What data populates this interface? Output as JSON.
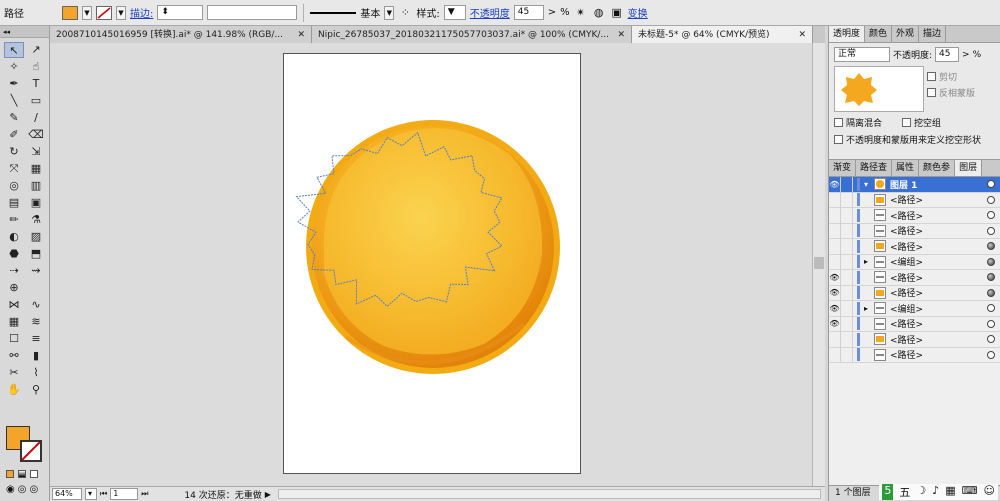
{
  "control": {
    "object_type": "路径",
    "stroke_label": "描边:",
    "stroke_style": "基本",
    "style_label": "样式:",
    "opacity_label": "不透明度",
    "opacity_value": "45",
    "opacity_unit": "%",
    "transform_label": "变换",
    "fill_color": "#f2a52a"
  },
  "tabs": [
    {
      "label": "20087101450169​59 [转换].ai* @ 141.98% (RGB/..."
    },
    {
      "label": "Nipic_26785037_20180321175057703037.ai* @ 100% (CMYK/..."
    },
    {
      "label": "未标题-5* @ 64% (CMYK/预览)"
    }
  ],
  "tools": [
    "↖",
    "↗",
    "✧",
    "☝",
    "✒",
    "T",
    "╲",
    "▭",
    "✎",
    "∕",
    "✐",
    "⌫",
    "↻",
    "⇲",
    "⤧",
    "▦",
    "◎",
    "▥",
    "▤",
    "▣",
    "✏",
    "⚗",
    "◐",
    "▨",
    "⬣",
    "⬒",
    "⇢",
    "⇝",
    "⊕",
    "",
    "⋈",
    "∿",
    "▦",
    "≋",
    "☐",
    "≡",
    "⚯",
    "▮",
    "✂",
    "⌇",
    "✋",
    "⚲"
  ],
  "tool_icons": {
    "selection": "selection-arrow-icon"
  },
  "status": {
    "zoom": "64%",
    "page": "1",
    "history": "14 次还原：无重做"
  },
  "transparency": {
    "tabs": [
      "透明度",
      "颜色",
      "外观",
      "描边"
    ],
    "mode": "正常",
    "opacity_label": "不透明度:",
    "opacity_value": "45",
    "opacity_unit": "%",
    "clip_label": "剪切",
    "invert_label": "反相蒙版",
    "isolate_label": "隔离混合",
    "knockout_label": "挖空组",
    "define_label": "不透明度和蒙版用来定义挖空形状"
  },
  "layers_panel": {
    "tabs": [
      "渐变",
      "路径查",
      "属性",
      "颜色参",
      "图层"
    ],
    "items": [
      {
        "name": "图层 1",
        "head": true,
        "eye": true,
        "target": "open"
      },
      {
        "name": "<路径>",
        "eye": false,
        "target": "open"
      },
      {
        "name": "<路径>",
        "eye": false,
        "target": "open"
      },
      {
        "name": "<路径>",
        "eye": false,
        "target": "open"
      },
      {
        "name": "<路径>",
        "eye": false,
        "target": "filled"
      },
      {
        "name": "<编组>",
        "eye": false,
        "target": "filled",
        "group": true
      },
      {
        "name": "<路径>",
        "eye": true,
        "target": "filled"
      },
      {
        "name": "<路径>",
        "eye": true,
        "target": "filled"
      },
      {
        "name": "<编组>",
        "eye": true,
        "target": "open",
        "group": true
      },
      {
        "name": "<路径>",
        "eye": true,
        "target": "open"
      },
      {
        "name": "<路径>",
        "eye": false,
        "target": "open"
      },
      {
        "name": "<路径>",
        "eye": false,
        "target": "open"
      }
    ],
    "footer": "1 个图层"
  },
  "colors": {
    "orange_main": "#f4a91e",
    "orange_dark": "#e07d08",
    "orange_light": "#f8c83a",
    "path_blue": "#5b7fc7",
    "layer_blue": "#3a70d4"
  },
  "ime": [
    "5",
    "五",
    "☽",
    "♪",
    "▦",
    "⌨",
    "☺"
  ]
}
